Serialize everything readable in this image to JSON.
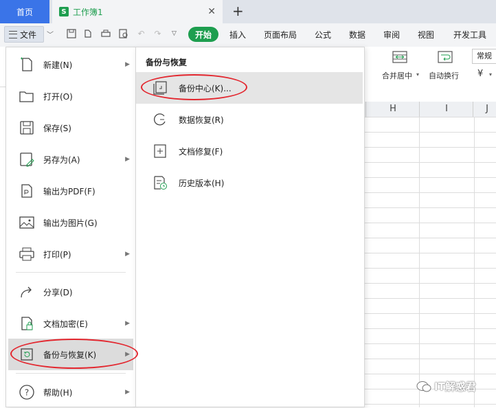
{
  "tabs": {
    "home_label": "首页",
    "document_label": "工作簿1",
    "document_icon_letter": "S"
  },
  "toolbar": {
    "file_label": "文件",
    "ribbon_tabs": [
      "开始",
      "插入",
      "页面布局",
      "公式",
      "数据",
      "审阅",
      "视图",
      "开发工具"
    ]
  },
  "ribbon": {
    "merge_center_label": "合并居中",
    "wrap_text_label": "自动换行",
    "number_format_value": "常规",
    "currency_symbol": "¥"
  },
  "sheet": {
    "column_headers": [
      "H",
      "I",
      "J"
    ]
  },
  "file_menu": {
    "items": [
      {
        "label": "新建(N)",
        "icon": "new-file-icon",
        "submenu": true
      },
      {
        "label": "打开(O)",
        "icon": "folder-icon",
        "submenu": false
      },
      {
        "label": "保存(S)",
        "icon": "save-icon",
        "submenu": false
      },
      {
        "label": "另存为(A)",
        "icon": "save-as-icon",
        "submenu": true
      },
      {
        "label": "输出为PDF(F)",
        "icon": "pdf-icon",
        "submenu": false
      },
      {
        "label": "输出为图片(G)",
        "icon": "image-icon",
        "submenu": false
      },
      {
        "label": "打印(P)",
        "icon": "printer-icon",
        "submenu": true
      },
      {
        "label": "分享(D)",
        "icon": "share-icon",
        "submenu": false
      },
      {
        "label": "文档加密(E)",
        "icon": "encrypt-icon",
        "submenu": true
      },
      {
        "label": "备份与恢复(K)",
        "icon": "backup-restore-icon",
        "submenu": true,
        "active": true
      },
      {
        "label": "帮助(H)",
        "icon": "help-icon",
        "submenu": true
      }
    ]
  },
  "backup_submenu": {
    "title": "备份与恢复",
    "items": [
      {
        "label": "备份中心(K)...",
        "icon": "backup-center-icon",
        "active": true
      },
      {
        "label": "数据恢复(R)",
        "icon": "data-recovery-icon"
      },
      {
        "label": "文档修复(F)",
        "icon": "document-repair-icon"
      },
      {
        "label": "历史版本(H)",
        "icon": "history-version-icon"
      }
    ]
  },
  "watermark": {
    "text": "IT解惑君"
  },
  "colors": {
    "accent_green": "#1e9e4f",
    "home_tab_blue": "#3a74e8",
    "highlight_red": "#e3262e"
  }
}
